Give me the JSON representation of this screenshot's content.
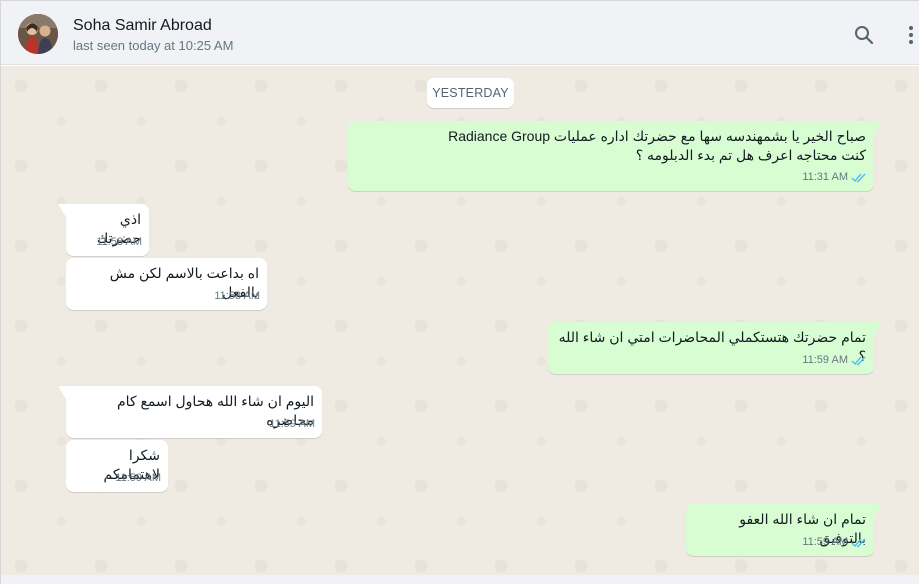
{
  "contact": {
    "name": "Soha Samir Abroad",
    "status": "last seen today at 10:25 AM"
  },
  "icons": {
    "search": "search-icon",
    "menu": "menu-vertical-icon",
    "read_receipt": "double-check-icon"
  },
  "colors": {
    "outgoing_bubble": "#d9fdd3",
    "incoming_bubble": "#ffffff",
    "chat_background": "#efeae2",
    "read_tick": "#53bdeb"
  },
  "date_divider": "YESTERDAY",
  "messages": [
    {
      "direction": "outgoing",
      "text": "صباح الخير يا بشمهندسه سها مع حضرتك اداره عمليات Radiance Group\nكنت محتاجه اعرف هل تم بدء الدبلومه ؟",
      "time": "11:31 AM",
      "read": true
    },
    {
      "direction": "incoming",
      "text": "اذي حضرتك",
      "time": "11:58 AM"
    },
    {
      "direction": "incoming",
      "text": "اه بداعت بالاسم لكن مش بالفعل",
      "time": "11:58 AM"
    },
    {
      "direction": "outgoing",
      "text": "تمام حضرتك هتستكملي المحاضرات امتي ان شاء الله ؟",
      "time": "11:59 AM",
      "read": true
    },
    {
      "direction": "incoming",
      "text": "اليوم ان شاء الله هحاول اسمع كام محاضره",
      "time": "11:59 AM"
    },
    {
      "direction": "incoming",
      "text": "شكرا لاهتمامكم",
      "time": "11:59 AM"
    },
    {
      "direction": "outgoing",
      "text": "تمام ان شاء الله العفو بالتوفيق",
      "time": "11:59 AM",
      "read": true
    }
  ]
}
